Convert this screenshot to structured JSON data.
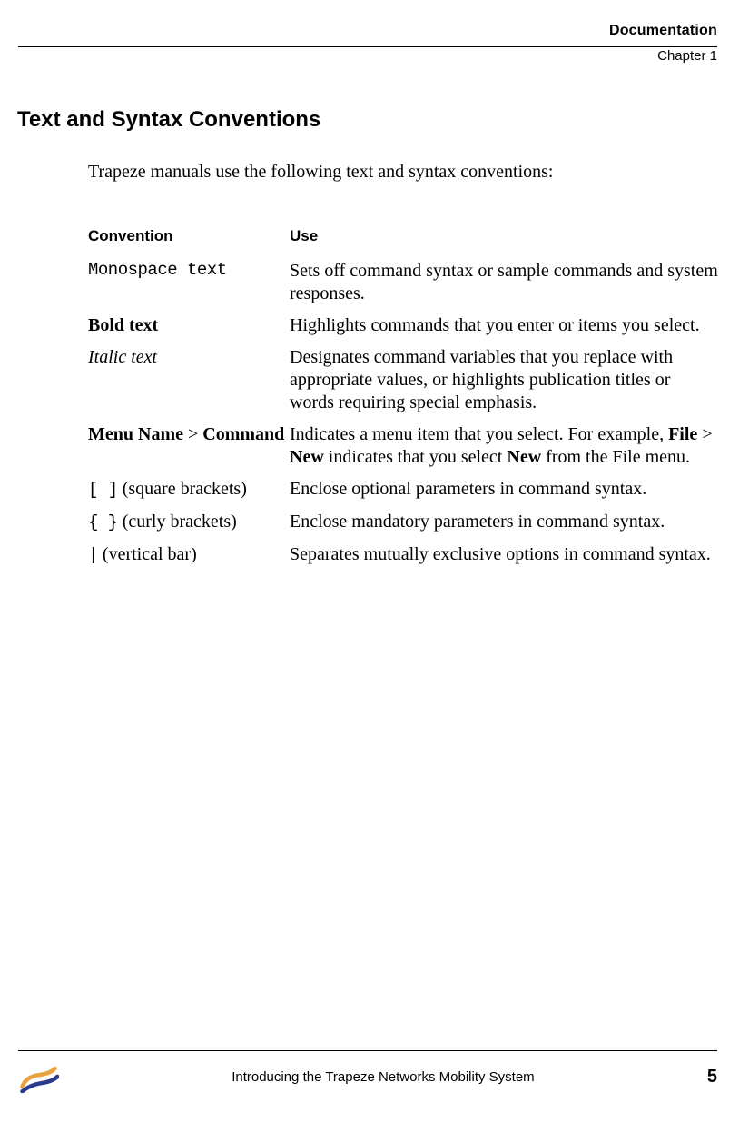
{
  "header": {
    "title": "Documentation",
    "chapter": "Chapter 1"
  },
  "section": {
    "title": "Text and Syntax Conventions",
    "intro": "Trapeze manuals use the following text and syntax conventions:"
  },
  "table": {
    "headers": {
      "convention": "Convention",
      "use": "Use"
    },
    "rows": [
      {
        "conv_mono": "Monospace text",
        "use": "Sets off command syntax or sample commands and system responses."
      },
      {
        "conv_bold": "Bold text",
        "use": "Highlights commands that you enter or items you select."
      },
      {
        "conv_italic": "Italic text",
        "use": "Designates command variables that you replace with appropriate values, or highlights publication titles or words requiring special emphasis."
      },
      {
        "menu_bold1": "Menu Name",
        "menu_gt": " > ",
        "menu_bold2": "Command",
        "use_pre": "Indicates a menu item that you select. For example, ",
        "use_b1": "File",
        "use_mid1": " > ",
        "use_b2": "New",
        "use_mid2": " indicates that you select ",
        "use_b3": "New",
        "use_post": " from the File menu."
      },
      {
        "conv_mono": "[ ]",
        "conv_text": " (square brackets)",
        "use": "Enclose optional parameters in command syntax."
      },
      {
        "conv_mono": "{ }",
        "conv_text": " (curly brackets)",
        "use": "Enclose mandatory parameters in command syntax."
      },
      {
        "conv_mono": "|",
        "conv_text": " (vertical bar)",
        "use": "Separates mutually exclusive options in command syntax."
      }
    ]
  },
  "footer": {
    "text": "Introducing the Trapeze Networks Mobility System",
    "page": "5"
  }
}
